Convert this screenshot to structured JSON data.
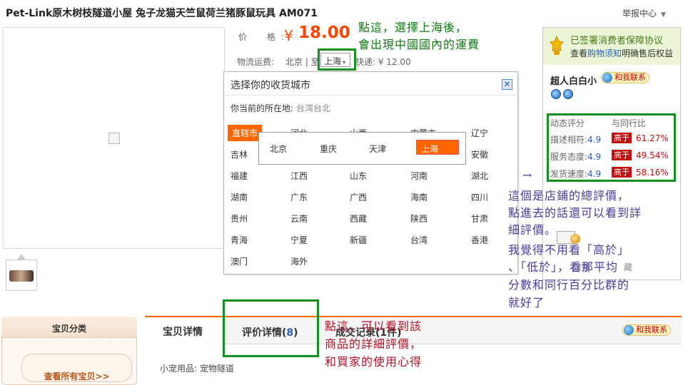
{
  "product": {
    "title": "Pet-Link原木树枝隧道小屋 兔子龙猫天竺鼠荷兰猪豚鼠玩具 AM071",
    "report": "举报中心",
    "price_label": "价　格:",
    "currency": "¥",
    "price": "18.00",
    "shipping_label": "物流运费:",
    "ship_from": "北京 | 至",
    "ship_to": "上海",
    "express": "快递: ¥ 12.00"
  },
  "city_popup": {
    "title": "选择你的收货城市",
    "current_label": "你当前的所在地:",
    "current_value": "台湾台北",
    "provinces": [
      "直辖市",
      "河北",
      "山西",
      "内蒙古",
      "辽宁",
      "吉林",
      "安徽",
      "福建",
      "江西",
      "山东",
      "河南",
      "湖北",
      "湖南",
      "广东",
      "广西",
      "海南",
      "四川",
      "贵州",
      "云南",
      "西藏",
      "陕西",
      "甘肃",
      "青海",
      "宁夏",
      "新疆",
      "台湾",
      "香港",
      "澳门",
      "海外"
    ],
    "municipalities": [
      "北京",
      "重庆",
      "天津",
      "上海"
    ]
  },
  "seller_panel": {
    "guarantee_title": "已签署消费者保障协议",
    "guarantee_sub_1": "查看",
    "guarantee_link": "购物须知",
    "guarantee_sub_2": "明确售后权益",
    "seller_name": "超人白白小",
    "contact": "和我联系",
    "rating_header": "动态评分",
    "compare_header": "与同行比",
    "ratings": [
      {
        "label": "描述相符:",
        "score": "4.9",
        "tag": "高于",
        "pct": "61.27%"
      },
      {
        "label": "服务态度:",
        "score": "4.9",
        "tag": "高于",
        "pct": "49.54%"
      },
      {
        "label": "发货速度:",
        "score": "4.9",
        "tag": "高于",
        "pct": "58.16%"
      }
    ],
    "shop_btn_1": "店铺",
    "shop_btn_2": "藏"
  },
  "sidebar": {
    "category_title": "宝贝分类",
    "view_all": "查看所有宝贝>>"
  },
  "tabs": {
    "items": [
      {
        "label": "宝贝详情"
      },
      {
        "label": "评价详情",
        "count": "8"
      },
      {
        "label": "成交记录",
        "count": "1件"
      }
    ],
    "contact": "和我联系"
  },
  "details": {
    "category_line": "小宠用品: 宠物隧道"
  },
  "annotations": {
    "top": [
      "點這，選擇上海後，",
      "會出現中國國內的運費"
    ],
    "right": [
      "這個是店鋪的總評價，",
      "點進去的話還可以看到詳",
      "細評價。",
      "我覺得不用看「高於」",
      "、「低於」，看那平均",
      "分數和同行百分比群的",
      "就好了"
    ],
    "bottom": [
      "點這，可以看到該",
      "商品的詳細評價，",
      "和買家的使用心得"
    ],
    "arrow": "→"
  },
  "colors": {
    "price": "#ff4400",
    "annotation_box": "#139020",
    "high_tag": "#c0100f",
    "tab_border": "#ff6600"
  }
}
